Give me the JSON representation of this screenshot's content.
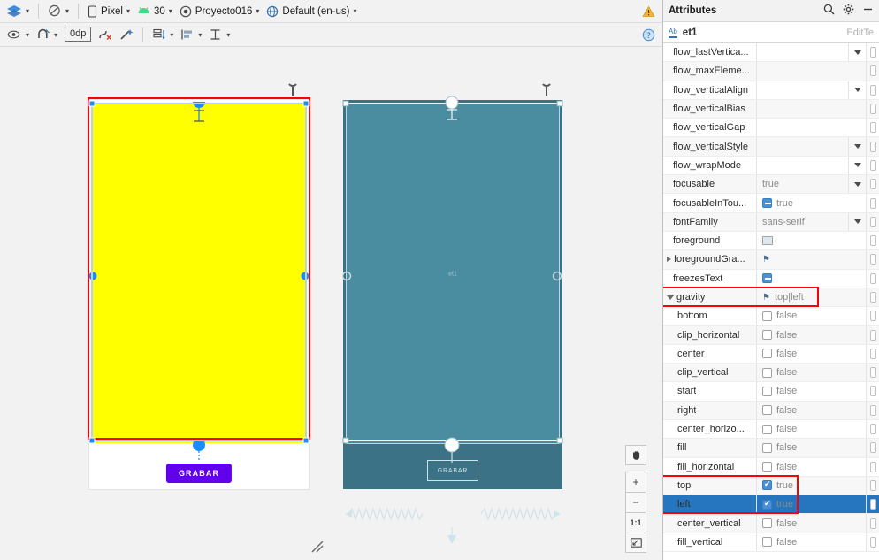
{
  "toolbar_top": {
    "design_mode_icon": "layers-icon",
    "orientation_icon": "no-theme-icon",
    "device": "Pixel",
    "device_icon": "phone-icon",
    "api": "30",
    "api_icon": "android-icon",
    "project": "Proyecto016",
    "project_icon": "theme-icon",
    "locale": "Default (en-us)",
    "locale_icon": "globe-icon",
    "warning_icon": "warning-icon"
  },
  "toolbar_second": {
    "items": [
      {
        "icon": "eye-icon",
        "name": "view-options-button"
      },
      {
        "icon": "magnet-icon",
        "name": "autoconnect-button"
      },
      {
        "icon": "margin-icon",
        "name": "default-margin-button",
        "label": "0dp"
      },
      {
        "icon": "clear-constraints-icon",
        "name": "clear-constraints-button"
      },
      {
        "icon": "magic-wand-icon",
        "name": "infer-constraints-button"
      },
      {
        "icon": "pack-icon",
        "name": "pack-button"
      },
      {
        "icon": "align-icon",
        "name": "align-button"
      },
      {
        "icon": "guideline-icon",
        "name": "guidelines-button"
      }
    ],
    "help_icon": "help-icon"
  },
  "canvas": {
    "device_design": {
      "widget_id": "et1",
      "widget_color": "#ffff00",
      "button_label": "GRABAR",
      "button_color": "#6200ee"
    },
    "device_blueprint": {
      "widget_id": "et1",
      "widget_color": "#4a8ca0",
      "button_label": "GRABAR",
      "surface_color": "#3c7285"
    },
    "selection_color": "#ff0000"
  },
  "zoom_controls": {
    "pan_icon": "hand-icon",
    "zoom_in": "+",
    "zoom_out": "−",
    "actual_size": "1:1",
    "fit_icon": "fit-to-screen-icon"
  },
  "attributes_panel": {
    "title": "Attributes",
    "search_icon": "search-icon",
    "gear_icon": "gear-icon",
    "minimize_icon": "minimize-icon",
    "component_badge": "Ab",
    "component_id": "et1",
    "component_type": "EditTe",
    "rows": [
      {
        "name": "flow_lastVertica...",
        "value": "",
        "control": "dropdown",
        "indent": 0
      },
      {
        "name": "flow_maxEleme...",
        "value": "",
        "control": "picker",
        "indent": 0
      },
      {
        "name": "flow_verticalAlign",
        "value": "",
        "control": "dropdown",
        "indent": 0
      },
      {
        "name": "flow_verticalBias",
        "value": "",
        "control": "picker",
        "indent": 0
      },
      {
        "name": "flow_verticalGap",
        "value": "",
        "control": "picker",
        "indent": 0
      },
      {
        "name": "flow_verticalStyle",
        "value": "",
        "control": "dropdown",
        "indent": 0
      },
      {
        "name": "flow_wrapMode",
        "value": "",
        "control": "dropdown",
        "indent": 0
      },
      {
        "name": "focusable",
        "value": "true",
        "control": "dropdown",
        "indent": 0
      },
      {
        "name": "focusableInTou...",
        "value": "true",
        "control": "checkbox-dash",
        "indent": 0
      },
      {
        "name": "fontFamily",
        "value": "sans-serif",
        "control": "dropdown",
        "indent": 0
      },
      {
        "name": "foreground",
        "value": "",
        "control": "image",
        "indent": 0
      },
      {
        "name": "foregroundGra...",
        "value": "",
        "control": "flag",
        "indent": 0,
        "expander": "collapsed"
      },
      {
        "name": "freezesText",
        "value": "",
        "control": "checkbox-dash",
        "indent": 0
      },
      {
        "name": "gravity",
        "value": "top|left",
        "control": "flag",
        "indent": 0,
        "expander": "expanded",
        "highlight": true
      },
      {
        "name": "bottom",
        "value": "false",
        "control": "checkbox-off",
        "indent": 1
      },
      {
        "name": "clip_horizontal",
        "value": "false",
        "control": "checkbox-off",
        "indent": 1
      },
      {
        "name": "center",
        "value": "false",
        "control": "checkbox-off",
        "indent": 1
      },
      {
        "name": "clip_vertical",
        "value": "false",
        "control": "checkbox-off",
        "indent": 1
      },
      {
        "name": "start",
        "value": "false",
        "control": "checkbox-off",
        "indent": 1
      },
      {
        "name": "right",
        "value": "false",
        "control": "checkbox-off",
        "indent": 1
      },
      {
        "name": "center_horizo...",
        "value": "false",
        "control": "checkbox-off",
        "indent": 1
      },
      {
        "name": "fill",
        "value": "false",
        "control": "checkbox-off",
        "indent": 1
      },
      {
        "name": "fill_horizontal",
        "value": "false",
        "control": "checkbox-off",
        "indent": 1
      },
      {
        "name": "top",
        "value": "true",
        "control": "checkbox-on",
        "indent": 1,
        "highlight": true
      },
      {
        "name": "left",
        "value": "true",
        "control": "checkbox-on",
        "indent": 1,
        "highlight": true,
        "selected": true
      },
      {
        "name": "center_vertical",
        "value": "false",
        "control": "checkbox-off",
        "indent": 1
      },
      {
        "name": "fill_vertical",
        "value": "false",
        "control": "checkbox-off",
        "indent": 1
      }
    ]
  }
}
